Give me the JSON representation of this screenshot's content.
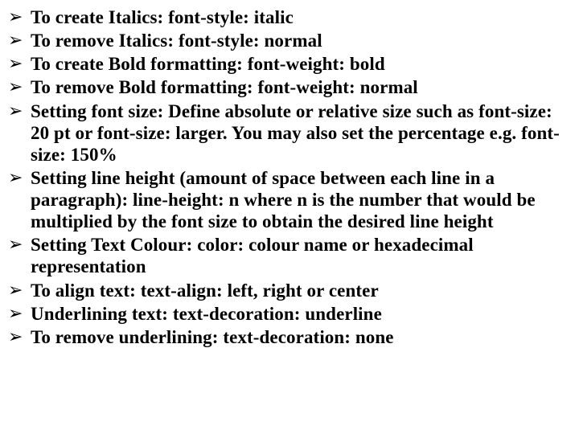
{
  "bullets": [
    {
      "marker": "➢",
      "text": "To create Italics: font-style: italic"
    },
    {
      "marker": "➢",
      "text": "To remove Italics: font-style: normal"
    },
    {
      "marker": "➢",
      "text": "To create Bold formatting: font-weight: bold"
    },
    {
      "marker": "➢",
      "text": "To remove Bold formatting: font-weight: normal"
    },
    {
      "marker": "➢",
      "text": "Setting font size: Define absolute or relative size such as font-size: 20 pt or font-size: larger. You may also set the percentage e.g. font-size: 150%"
    },
    {
      "marker": "➢",
      "text": "Setting line height (amount of space between each line in a paragraph): line-height: n where n is the number that would be multiplied by the font size to obtain the desired line height"
    },
    {
      "marker": "➢",
      "text": "Setting Text Colour: color: colour name or hexadecimal representation"
    },
    {
      "marker": "➢",
      "text": "To align text: text-align: left, right or center"
    },
    {
      "marker": "➢",
      "text": "Underlining text: text-decoration: underline"
    },
    {
      "marker": "➢",
      "text": "To remove underlining: text-decoration: none"
    }
  ]
}
